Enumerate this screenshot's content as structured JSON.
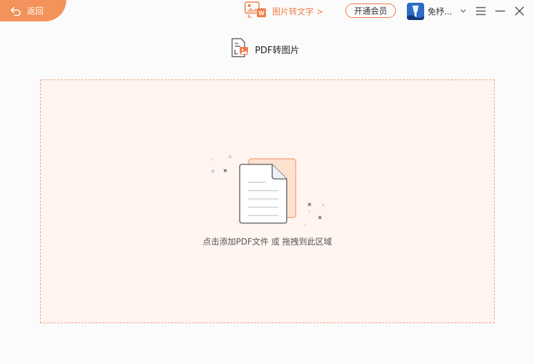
{
  "header": {
    "back_label": "返回",
    "promo_label": "图片转文字 >",
    "vip_label": "开通会员",
    "username": "免...",
    "username_display": "免杼..."
  },
  "tool": {
    "title": "PDF转图片"
  },
  "dropzone": {
    "hint": "点击添加PDF文件 或 拖拽到此区域"
  },
  "colors": {
    "accent": "#f3925b",
    "accent_text": "#f07c46",
    "dropzone_bg": "#fff4f0",
    "dropzone_border": "#f2a27d"
  },
  "icons": {
    "back": "back-arrow-icon",
    "promo": "image-to-text-icon",
    "chevron": "chevron-down-icon",
    "menu": "menu-icon",
    "minimize": "minimize-icon",
    "close": "close-icon",
    "tool": "pdf-to-image-icon",
    "illustration": "document-illustration"
  }
}
